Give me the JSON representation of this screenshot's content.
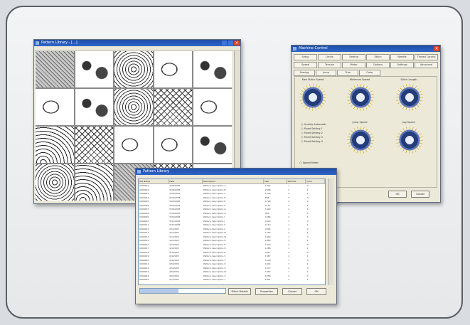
{
  "windows": {
    "pattern_library": {
      "title": "Pattern Library - [...]",
      "tiles": [
        "a",
        "b",
        "c",
        "e",
        "b",
        "e",
        "b",
        "c",
        "d",
        "e",
        "f",
        "d",
        "e",
        "e",
        "b",
        "c",
        "f",
        "a",
        "d",
        "e"
      ]
    },
    "machine_control": {
      "title": "Machine Control",
      "tabs_row1": [
        "Setup",
        "Limits",
        "Sewing",
        "Stitch",
        "Needle",
        "Thread Control"
      ],
      "tabs_row2": [
        "Speed",
        "Tension",
        "Motor",
        "Options",
        "Settings",
        "Advanced"
      ],
      "tabs_row3": [
        "Sewing",
        "Jump",
        "Trim",
        "Color"
      ],
      "dials": [
        {
          "label": "Max Stitch Speed"
        },
        {
          "label": "Minimum Speed"
        },
        {
          "label": "Stitch Length"
        },
        {
          "label": "Jump Speed"
        },
        {
          "label": "Jog Speed"
        }
      ],
      "radio_options": [
        "Quality Automatic",
        "Fixed Setting 1",
        "Fixed Setting 2",
        "Fixed Setting 3",
        "Fixed Setting 4"
      ],
      "status_label": "Speed Meter",
      "bottom_label": "Mode",
      "ok_label": "OK",
      "cancel_label": "Cancel"
    },
    "data_list": {
      "title": "Pattern Library",
      "columns": [
        "File Name",
        "Date",
        "Description",
        "Size",
        "Stitches",
        "Color"
      ],
      "rows": [
        [
          "0000001",
          "3/28/2005",
          "Pattern description A",
          "1024",
          "1",
          "0"
        ],
        [
          "0000002",
          "3/28/2005",
          "Pattern description B",
          "2048",
          "2",
          "1"
        ],
        [
          "0000003",
          "3/28/2005",
          "Pattern description C",
          "1536",
          "2",
          "1"
        ],
        [
          "0000004",
          "3/29/2005",
          "Pattern description D",
          "896",
          "3",
          "0"
        ],
        [
          "0000005",
          "3/29/2005",
          "Pattern description E",
          "1728",
          "2",
          "0"
        ],
        [
          "0000006",
          "3/29/2005",
          "Pattern description F",
          "2112",
          "1",
          "1"
        ],
        [
          "0000007",
          "3/30/2005",
          "Pattern description G",
          "1420",
          "2",
          "1"
        ],
        [
          "0000008",
          "3/30/2005",
          "Pattern description H",
          "980",
          "1",
          "0"
        ],
        [
          "0000009",
          "3/30/2005",
          "Pattern description I",
          "1666",
          "2",
          "1"
        ],
        [
          "0000010",
          "3/31/2005",
          "Pattern description J",
          "1320",
          "3",
          "0"
        ],
        [
          "0000011",
          "3/31/2005",
          "Pattern description K",
          "1110",
          "1",
          "1"
        ],
        [
          "0000012",
          "4/1/2005",
          "Pattern description L",
          "2204",
          "2",
          "0"
        ],
        [
          "0000013",
          "4/1/2005",
          "Pattern description M",
          "1755",
          "2",
          "1"
        ],
        [
          "0000014",
          "4/1/2005",
          "Pattern description N",
          "1002",
          "1",
          "0"
        ],
        [
          "0000015",
          "4/2/2005",
          "Pattern description O",
          "1890",
          "3",
          "1"
        ],
        [
          "0000016",
          "4/2/2005",
          "Pattern description P",
          "1433",
          "2",
          "0"
        ],
        [
          "0000017",
          "4/3/2005",
          "Pattern description Q",
          "1288",
          "1",
          "1"
        ],
        [
          "0000018",
          "4/3/2005",
          "Pattern description R",
          "2011",
          "2",
          "0"
        ],
        [
          "0000019",
          "4/4/2005",
          "Pattern description S",
          "1567",
          "2",
          "1"
        ],
        [
          "0000020",
          "4/4/2005",
          "Pattern description T",
          "1190",
          "1",
          "0"
        ],
        [
          "0000021",
          "4/5/2005",
          "Pattern description U",
          "1644",
          "3",
          "1"
        ],
        [
          "0000022",
          "4/5/2005",
          "Pattern description V",
          "1377",
          "2",
          "0"
        ],
        [
          "0000023",
          "4/6/2005",
          "Pattern description W",
          "1902",
          "1",
          "1"
        ],
        [
          "0000024",
          "4/6/2005",
          "Pattern description X",
          "1256",
          "2",
          "0"
        ],
        [
          "0000025",
          "4/7/2005",
          "Pattern description Y",
          "1801",
          "2",
          "1"
        ]
      ],
      "progress": 0.45,
      "buttons": [
        "Stitch Details",
        "Properties",
        "Cancel",
        "OK"
      ]
    }
  }
}
